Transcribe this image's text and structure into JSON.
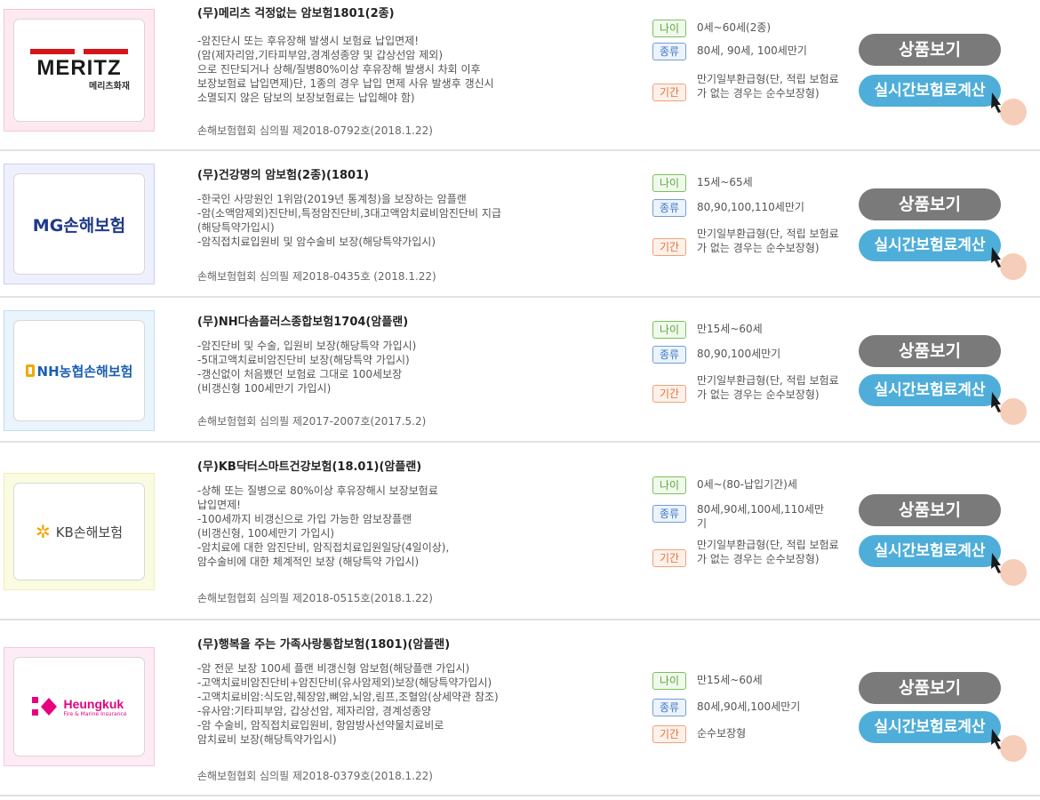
{
  "products": [
    {
      "company": "메리츠화재",
      "logo_text": "MERITZ",
      "logo_sub": "메리츠화재",
      "title": "(무)메리츠 걱정없는 암보험1801(2종)",
      "desc": [
        "-암진단시 또는 후유장해 발생시 보험료 납입면제!",
        "(암(제자리암,기타피부암,경계성종양 및 갑상선암 제외)",
        "으로 진단되거나 상해/질병80%이상 후유장해 발생시 차회 이후",
        "보장보험료 납입면제)단, 1종의 경우 납입 면제 사유 발생후 갱신시",
        "소멸되지 않은 담보의 보장보험료는 납입해야 함)"
      ],
      "approval": "손해보험협회 심의필 제2018-0792호(2018.1.22)",
      "age": "0세~60세(2종)",
      "type": "80세, 90세, 100세만기",
      "term": "만기일부환급형(단, 적립 보험료가 없는 경우는 순수보장형)"
    },
    {
      "company": "MG손해보험",
      "logo_text": "MG손해보험",
      "title": "(무)건강명의 암보험(2종)(1801)",
      "desc": [
        "-한국인 사망원인 1위암(2019년 통계청)을 보장하는 암플랜",
        "-암(소액암제외)진단비,특정암진단비,3대고액암치료비암진단비 지급",
        "(해당특약가입시)",
        "-암직접치료입원비 및 암수술비 보장(해당특약가입시)"
      ],
      "approval": "손해보험협회 심의필 제2018-0435호 (2018.1.22)",
      "age": "15세~65세",
      "type": "80,90,100,110세만기",
      "term": "만기일부환급형(단, 적립 보험료가 없는 경우는 순수보장형)"
    },
    {
      "company": "NH농협손해보험",
      "logo_text": "NH농협손해보험",
      "title": "(무)NH다솜플러스종합보험1704(암플랜)",
      "desc": [
        "-암진단비 및 수술, 입원비 보장(해당특약 가입시)",
        "-5대고액치료비암진단비 보장(해당특약 가입시)",
        "-갱신없이 처음뵀던 보험료 그대로 100세보장",
        "(비갱신형 100세만기 가입시)"
      ],
      "approval": "손해보험협회 심의필 제2017-2007호(2017.5.2)",
      "age": "만15세~60세",
      "type": "80,90,100세만기",
      "term": "만기일부환급형(단, 적립 보험료가 없는 경우는 순수보장형)"
    },
    {
      "company": "KB손해보험",
      "logo_text": "KB손해보험",
      "title": "(무)KB닥터스마트건강보험(18.01)(암플랜)",
      "desc": [
        "-상해 또는 질병으로 80%이상 후유장해시 보장보험료",
        "납입면제!",
        "-100세까지 비갱신으로 가입 가능한 암보장플랜",
        "(비갱신형, 100세만기 가입시)",
        "-암치료에 대한 암진단비, 암직접치료입원일당(4일이상),",
        "암수술비에 대한 체계적인 보장 (해당특약 가입시)"
      ],
      "approval": "손해보험협회 심의필 제2018-0515호(2018.1.22)",
      "age": "0세~(80-납입기간)세",
      "type": "80세,90세,100세,110세만기",
      "term": "만기일부환급형(단, 적립 보험료가 없는 경우는 순수보장형)"
    },
    {
      "company": "흥국화재",
      "logo_text": "Heungkuk",
      "logo_sub": "Fire & Marine Insurance",
      "title": "(무)행복을 주는 가족사랑통합보험(1801)(암플랜)",
      "desc": [
        "-암 전문 보장 100세 플랜 비갱신형 암보험(해당플랜 가입시)",
        "-고액치료비암진단비+암진단비(유사암제외)보장(해당특약가입시)",
        "-고액치료비암:식도암,췌장암,뼈암,뇌암,림프,조혈암(상세약관 참조)",
        "-유사암:기타피부암, 갑상선암, 제자리암, 경계성종양",
        "-암 수술비, 암직접치료입원비, 항암방사선약물치료비로",
        "암치료비 보장(해당특약가입시)"
      ],
      "approval": "손해보험협회 심의필 제2018-0379호(2018.1.22)",
      "age": "만15세~60세",
      "type": "80세,90세,100세만기",
      "term": "순수보장형"
    }
  ],
  "labels": {
    "age": "나이",
    "type": "종류",
    "term": "기간",
    "view_button": "상품보기",
    "calc_button": "실시간보험료계산"
  },
  "colors": {
    "meritz_red": "#d7141a",
    "mg_navy": "#1e3a8a",
    "nh_blue": "#1a5fb4",
    "kb_yellow": "#f5a300",
    "heungkuk_pink": "#e6007e",
    "view_button_bg": "#7a7a7a",
    "calc_button_bg": "#4eaed9"
  }
}
